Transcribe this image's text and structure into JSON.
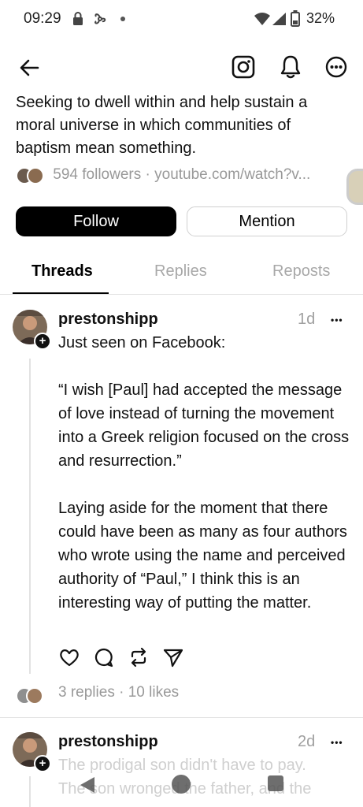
{
  "status_bar": {
    "time": "09:29",
    "battery": "32%"
  },
  "nav": {
    "back_icon": "arrow-left-icon",
    "instagram_icon": "instagram-icon",
    "bell_icon": "bell-icon",
    "more_icon": "more-horizontal-icon"
  },
  "profile": {
    "bio": "Seeking to dwell within and help sustain a moral universe in which communities of baptism mean something.",
    "followers": "594 followers",
    "separator": "·",
    "link": "youtube.com/watch?v..."
  },
  "buttons": {
    "follow": "Follow",
    "mention": "Mention"
  },
  "tabs": [
    {
      "label": "Threads",
      "active": true
    },
    {
      "label": "Replies",
      "active": false
    },
    {
      "label": "Reposts",
      "active": false
    }
  ],
  "posts": [
    {
      "username": "prestonshipp",
      "time": "1d",
      "more": "•••",
      "text": "Just seen on Facebook:\n\n“I wish [Paul] had accepted the message of love instead of turning the movement into a Greek religion focused on the cross and resurrection.”\n\nLaying aside for the moment that there could have been as many as four authors who wrote using the name and perceived authority of “Paul,” I think this is an interesting way of putting the matter.",
      "replies": "3 replies",
      "likes": "10 likes",
      "stats_sep": "·"
    },
    {
      "username": "prestonshipp",
      "time": "2d",
      "more": "•••",
      "text": "The prodigal son didn't have to pay.\nThe son wronged the father, and the"
    }
  ],
  "colors": {
    "accent": "#000000",
    "muted": "#999999",
    "divider": "#e3e3e3"
  }
}
